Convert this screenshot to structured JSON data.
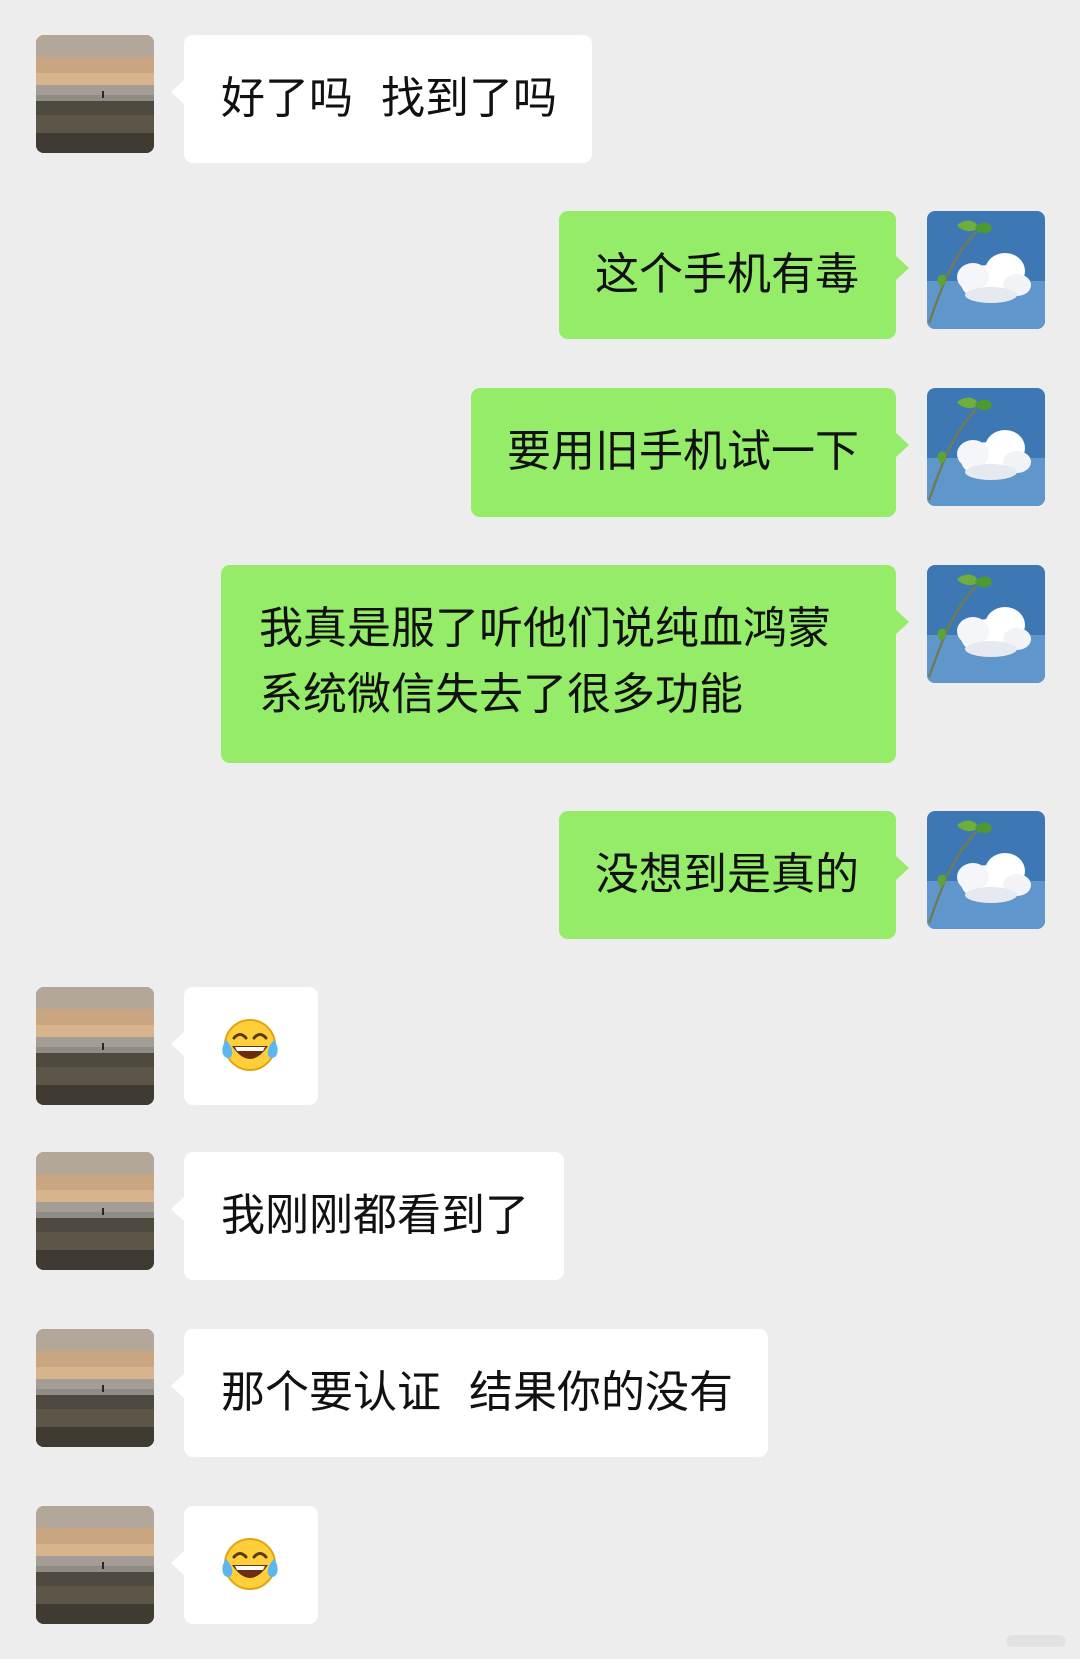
{
  "colors": {
    "background": "#ededed",
    "incoming_bubble": "#ffffff",
    "outgoing_bubble": "#95ec69",
    "text": "#111111"
  },
  "avatars": {
    "contact": "sunset-beach-avatar",
    "self": "cloud-sky-avatar"
  },
  "messages": [
    {
      "side": "incoming",
      "text": "好了吗  找到了吗"
    },
    {
      "side": "outgoing",
      "text": "这个手机有毒"
    },
    {
      "side": "outgoing",
      "text": "要用旧手机试一下"
    },
    {
      "side": "outgoing",
      "text": "我真是服了听他们说纯血鸿蒙系统微信失去了很多功能"
    },
    {
      "side": "outgoing",
      "text": "没想到是真的"
    },
    {
      "side": "incoming",
      "emoji": "tears-of-joy-emoji"
    },
    {
      "side": "incoming",
      "text": "我刚刚都看到了"
    },
    {
      "side": "incoming",
      "text": "那个要认证  结果你的没有"
    },
    {
      "side": "incoming",
      "emoji": "tears-of-joy-emoji"
    }
  ]
}
